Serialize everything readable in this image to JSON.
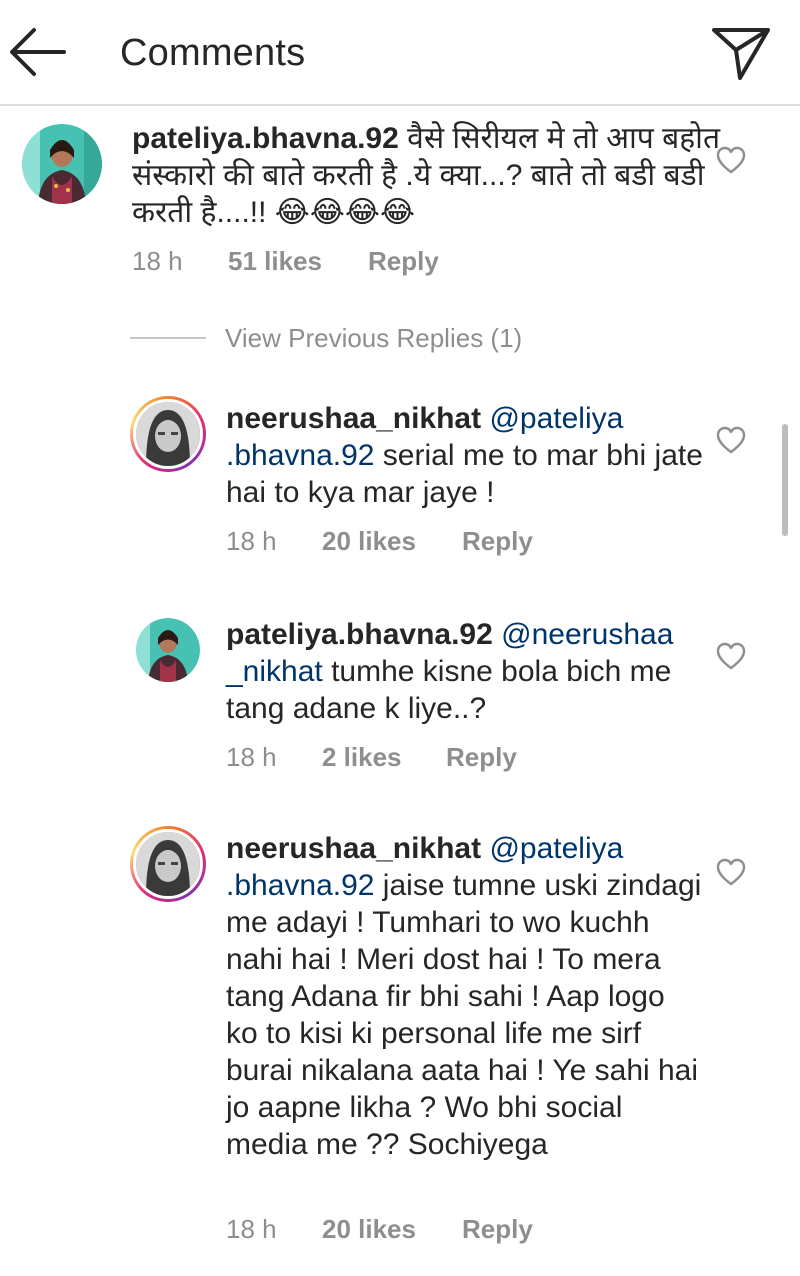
{
  "header": {
    "title": "Comments",
    "back_icon": "arrow-left-icon",
    "share_icon": "paper-plane-icon"
  },
  "view_previous_replies": "View Previous Replies (1)",
  "comments": [
    {
      "username": "pateliya.bhavna.92",
      "mention_a": "",
      "mention_b": "",
      "body": "वैसे सिरीयल मे तो आप बहोत संस्कारो की बाते करती है .ये क्या...? बाते तो बडी बडी करती है....!! 😂😂😂😂",
      "time": "18 h",
      "likes": "51 likes",
      "reply": "Reply"
    },
    {
      "username": "neerushaa_nikhat",
      "mention_a": "@pateliya",
      "mention_b": ".bhavna.92",
      "body": " serial me to mar bhi jate hai to kya mar jaye !",
      "time": "18 h",
      "likes": "20 likes",
      "reply": "Reply"
    },
    {
      "username": "pateliya.bhavna.92",
      "mention_a": "@neerushaa",
      "mention_b": "_nikhat",
      "body": " tumhe kisne bola bich me tang adane k liye..?",
      "time": "18 h",
      "likes": "2 likes",
      "reply": "Reply"
    },
    {
      "username": "neerushaa_nikhat",
      "mention_a": "@pateliya",
      "mention_b": ".bhavna.92",
      "body": " jaise tumne uski zindagi me adayi ! Tumhari to wo kuchh nahi hai ! Meri  dost hai ! To mera tang Adana fir bhi sahi ! Aap logo ko to kisi ki personal life me sirf burai nikalana aata hai ! Ye sahi hai jo aapne likha ? Wo bhi social media me ?? Sochiyega",
      "time": "18 h",
      "likes": "20 likes",
      "reply": "Reply"
    }
  ],
  "colors": {
    "text": "#262626",
    "meta": "#8e8e8e",
    "mention": "#003569",
    "divider": "#dbdbdb"
  }
}
